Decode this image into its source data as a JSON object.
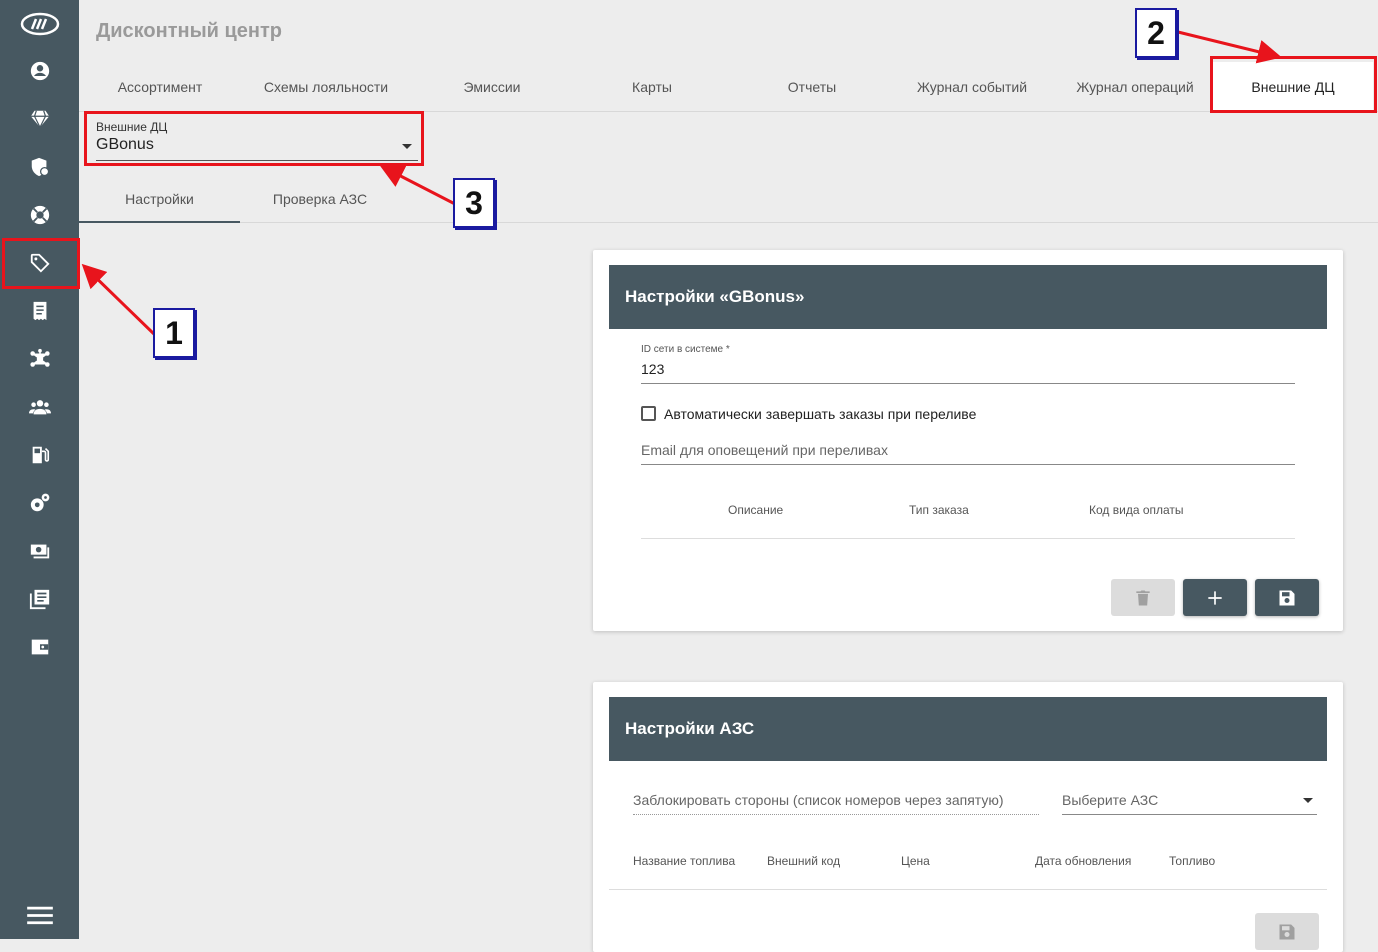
{
  "page": {
    "title": "Дисконтный центр"
  },
  "tabs": [
    {
      "label": "Ассортимент"
    },
    {
      "label": "Схемы лояльности"
    },
    {
      "label": "Эмиссии"
    },
    {
      "label": "Карты"
    },
    {
      "label": "Отчеты"
    },
    {
      "label": "Журнал событий"
    },
    {
      "label": "Журнал операций"
    },
    {
      "label": "Внешние ДЦ",
      "active": true
    }
  ],
  "external_dc_select": {
    "label": "Внешние ДЦ",
    "value": "GBonus"
  },
  "subtabs": [
    {
      "label": "Настройки",
      "active": true
    },
    {
      "label": "Проверка АЗС"
    }
  ],
  "settings_card": {
    "title": "Настройки «GBonus»",
    "network_id_label": "ID сети в системе *",
    "network_id_value": "123",
    "auto_complete_label": "Автоматически завершать заказы при переливе",
    "auto_complete_checked": false,
    "email_placeholder": "Email для оповещений при переливах",
    "columns": [
      "Описание",
      "Тип заказа",
      "Код вида оплаты"
    ]
  },
  "azs_card": {
    "title": "Настройки АЗС",
    "block_sides_placeholder": "Заблокировать стороны (список номеров через запятую)",
    "select_azs_placeholder": "Выберите АЗС",
    "columns": [
      "Название топлива",
      "Внешний код",
      "Цена",
      "Дата обновления",
      "Топливо"
    ]
  },
  "sidebar": {
    "icons": [
      "logo-icon",
      "account-icon",
      "diamond-icon",
      "shield-icon",
      "lifebuoy-icon",
      "tag-icon",
      "receipt-icon",
      "network-icon",
      "group-icon",
      "fuel-station-icon",
      "gears-icon",
      "cash-icon",
      "library-icon",
      "wallet-icon",
      "menu-icon"
    ],
    "active": "tag-icon"
  },
  "annotations": {
    "badge1": "1",
    "badge2": "2",
    "badge3": "3"
  },
  "colors": {
    "sidebar": "#475861",
    "header": "#475861",
    "annotation": "#e8141c",
    "badge_border": "#1a1aa0"
  }
}
